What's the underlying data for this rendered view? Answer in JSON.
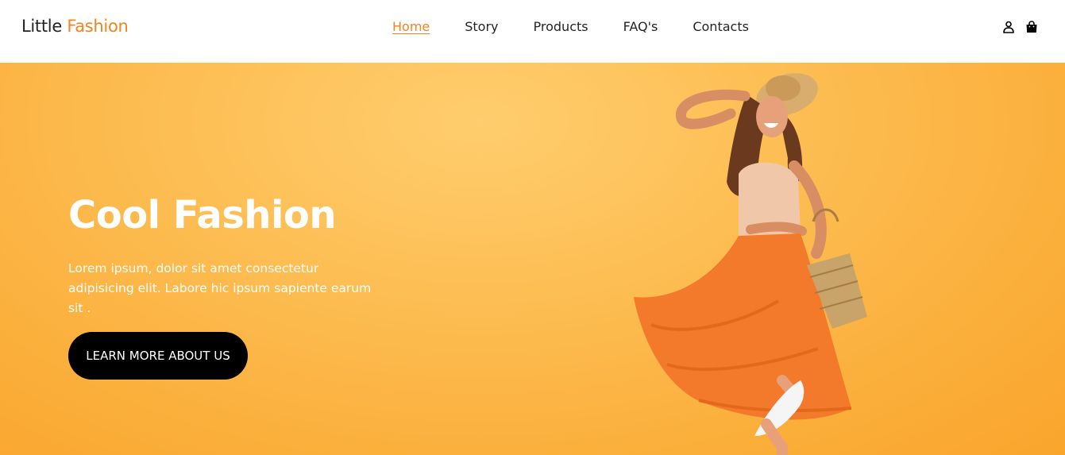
{
  "brand": {
    "name_part1": "Little",
    "name_part2": "Fashion",
    "accent_color": "#f3831f"
  },
  "nav": {
    "items": [
      {
        "label": "Home",
        "active": true
      },
      {
        "label": "Story",
        "active": false
      },
      {
        "label": "Products",
        "active": false
      },
      {
        "label": "FAQ's",
        "active": false
      },
      {
        "label": "Contacts",
        "active": false
      }
    ],
    "icons": [
      "user-icon",
      "shopping-bag-icon"
    ]
  },
  "hero": {
    "title": "Cool Fashion",
    "text": "Lorem ipsum, dolor sit amet consectetur adipisicing elit. Labore hic ipsum sapiente earum sit .",
    "button_label": "LEARN MORE ABOUT US",
    "background_color": "#fbb03d",
    "image": "woman-in-orange-dress-photo"
  }
}
